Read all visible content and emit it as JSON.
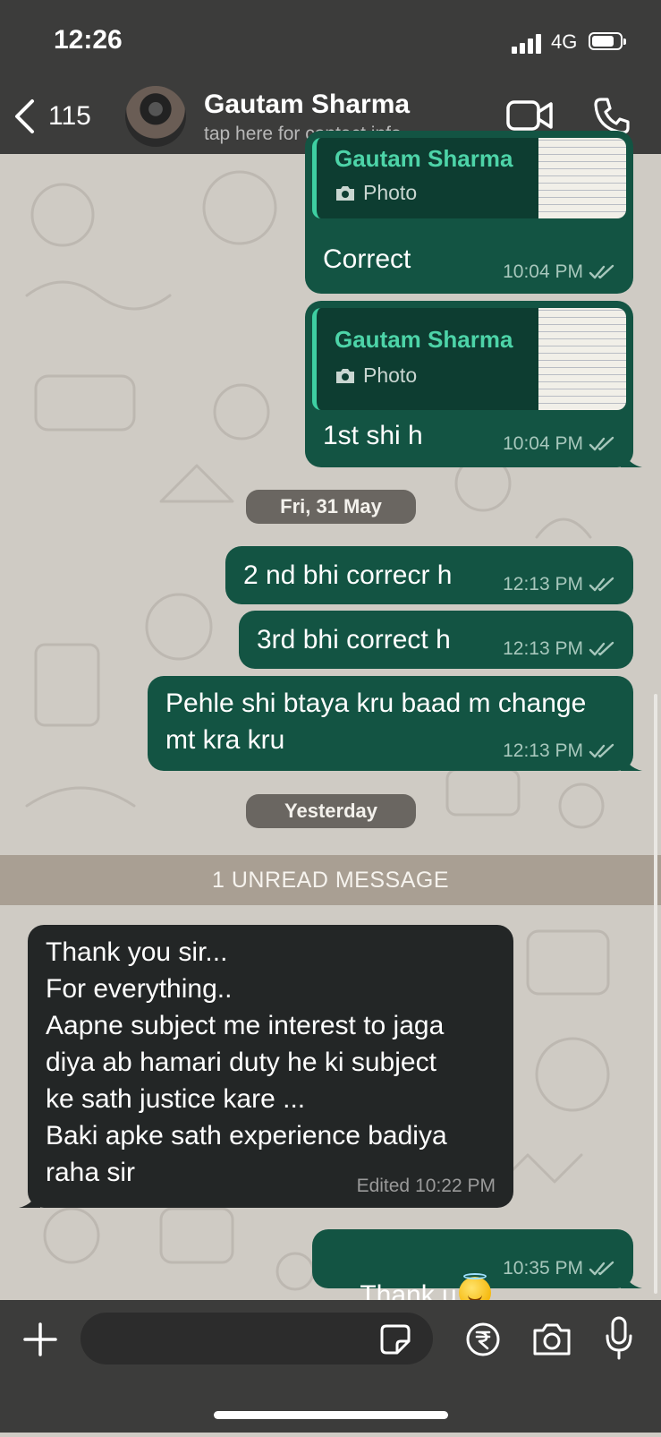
{
  "status_bar": {
    "time": "12:26",
    "network": "4G"
  },
  "header": {
    "back_count": "115",
    "contact_name": "Gautam Sharma",
    "contact_sub": "tap here for contact info"
  },
  "messages": [
    {
      "direction": "out",
      "quote": {
        "name": "Gautam Sharma",
        "type": "Photo"
      },
      "text": "Correct",
      "time": "10:04 PM"
    },
    {
      "direction": "out",
      "quote": {
        "name": "Gautam Sharma",
        "type": "Photo"
      },
      "text": "1st shi h",
      "time": "10:04 PM"
    },
    {
      "direction": "out",
      "text": "2 nd bhi correcr h",
      "time": "12:13 PM"
    },
    {
      "direction": "out",
      "text": "3rd bhi correct h",
      "time": "12:13 PM"
    },
    {
      "direction": "out",
      "text": "Pehle shi btaya kru baad m change\nmt kra kru",
      "time": "12:13 PM"
    },
    {
      "direction": "in",
      "text": "Thank you sir...\nFor everything..\nAapne subject me interest to jaga\ndiya ab hamari duty he ki subject\nke sath justice kare ...\nBaki apke sath experience badiya\nraha sir",
      "edited": "Edited",
      "time": "10:22 PM"
    },
    {
      "direction": "out",
      "text": "Thank u",
      "emoji": "smiling-face-with-halo",
      "time": "10:35 PM"
    }
  ],
  "dates": {
    "first": "Fri, 31 May",
    "second": "Yesterday"
  },
  "unread_banner": "1 UNREAD MESSAGE",
  "composer": {
    "placeholder": ""
  },
  "colors": {
    "outgoing": "#135443",
    "incoming": "#232626",
    "quote_name": "#4dd4a8",
    "header": "#3c3c3b"
  }
}
